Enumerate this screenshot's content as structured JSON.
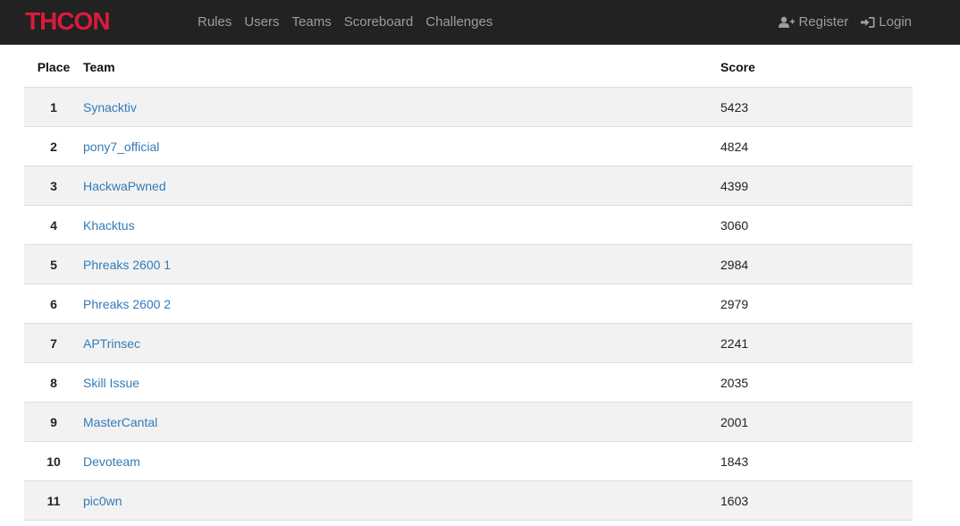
{
  "brand": {
    "logo_text": "THCON",
    "color": "#d81b3c"
  },
  "nav": {
    "links": [
      "Rules",
      "Users",
      "Teams",
      "Scoreboard",
      "Challenges"
    ],
    "register_label": "Register",
    "login_label": "Login",
    "register_icon": "user-plus-icon",
    "login_icon": "sign-in-icon"
  },
  "table": {
    "headers": {
      "place": "Place",
      "team": "Team",
      "score": "Score"
    },
    "rows": [
      {
        "place": "1",
        "team": "Synacktiv",
        "score": "5423"
      },
      {
        "place": "2",
        "team": "pony7_official",
        "score": "4824"
      },
      {
        "place": "3",
        "team": "HackwaPwned",
        "score": "4399"
      },
      {
        "place": "4",
        "team": "Khacktus",
        "score": "3060"
      },
      {
        "place": "5",
        "team": "Phreaks 2600 1",
        "score": "2984"
      },
      {
        "place": "6",
        "team": "Phreaks 2600 2",
        "score": "2979"
      },
      {
        "place": "7",
        "team": "APTrinsec",
        "score": "2241"
      },
      {
        "place": "8",
        "team": "Skill Issue",
        "score": "2035"
      },
      {
        "place": "9",
        "team": "MasterCantal",
        "score": "2001"
      },
      {
        "place": "10",
        "team": "Devoteam",
        "score": "1843"
      },
      {
        "place": "11",
        "team": "pic0wn",
        "score": "1603"
      }
    ]
  },
  "colors": {
    "navbar_bg": "#222222",
    "nav_text": "#9d9d9d",
    "link": "#337ab7",
    "stripe": "#f2f2f2"
  }
}
